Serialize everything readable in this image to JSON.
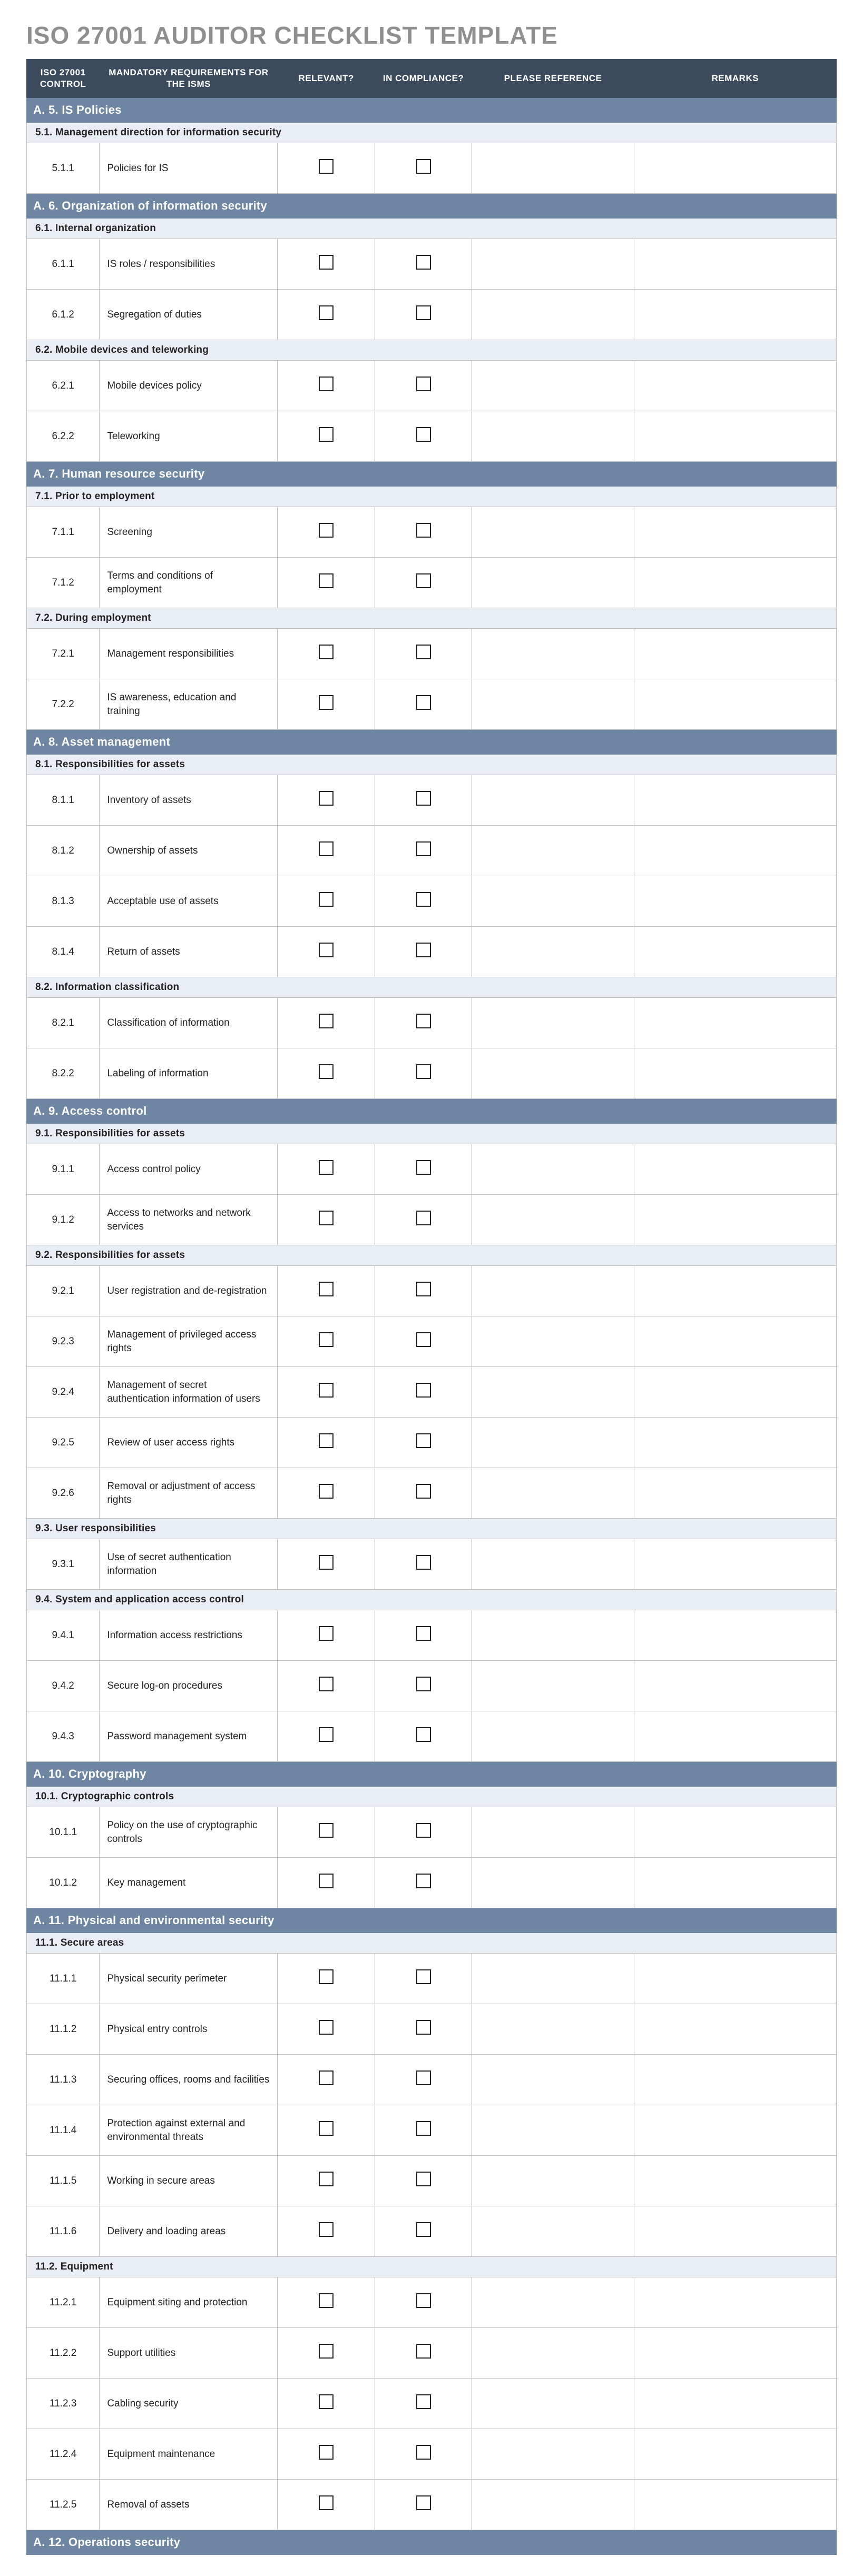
{
  "title": "ISO 27001 AUDITOR CHECKLIST TEMPLATE",
  "columns": {
    "control": "ISO 27001\nCONTROL",
    "req": "MANDATORY REQUIREMENTS\nFOR THE ISMS",
    "relevant": "RELEVANT?",
    "compliance": "IN COMPLIANCE?",
    "reference": "PLEASE REFERENCE",
    "remarks": "REMARKS"
  },
  "sections": [
    {
      "label": "A. 5. IS Policies",
      "subs": [
        {
          "label": "5.1. Management direction for information security",
          "rows": [
            {
              "c": "5.1.1",
              "t": "Policies for IS"
            }
          ]
        }
      ]
    },
    {
      "label": "A. 6. Organization of information security",
      "subs": [
        {
          "label": "6.1. Internal organization",
          "rows": [
            {
              "c": "6.1.1",
              "t": "IS roles / responsibilities"
            },
            {
              "c": "6.1.2",
              "t": "Segregation of duties"
            }
          ]
        },
        {
          "label": "6.2. Mobile devices and teleworking",
          "rows": [
            {
              "c": "6.2.1",
              "t": "Mobile devices policy"
            },
            {
              "c": "6.2.2",
              "t": "Teleworking"
            }
          ]
        }
      ]
    },
    {
      "label": "A. 7. Human resource security",
      "subs": [
        {
          "label": "7.1. Prior to employment",
          "rows": [
            {
              "c": "7.1.1",
              "t": "Screening"
            },
            {
              "c": "7.1.2",
              "t": "Terms and conditions of employment"
            }
          ]
        },
        {
          "label": "7.2. During employment",
          "rows": [
            {
              "c": "7.2.1",
              "t": "Management responsibilities"
            },
            {
              "c": "7.2.2",
              "t": "IS awareness, education and training"
            }
          ]
        }
      ]
    },
    {
      "label": "A. 8. Asset management",
      "subs": [
        {
          "label": "8.1. Responsibilities for assets",
          "rows": [
            {
              "c": "8.1.1",
              "t": "Inventory of assets"
            },
            {
              "c": "8.1.2",
              "t": "Ownership of assets"
            },
            {
              "c": "8.1.3",
              "t": "Acceptable use of assets"
            },
            {
              "c": "8.1.4",
              "t": "Return of assets"
            }
          ]
        },
        {
          "label": "8.2. Information classification",
          "rows": [
            {
              "c": "8.2.1",
              "t": "Classification of information"
            },
            {
              "c": "8.2.2",
              "t": "Labeling of information"
            }
          ]
        }
      ]
    },
    {
      "label": "A. 9. Access control",
      "subs": [
        {
          "label": "9.1. Responsibilities for assets",
          "rows": [
            {
              "c": "9.1.1",
              "t": "Access control policy"
            },
            {
              "c": "9.1.2",
              "t": "Access to networks and network services"
            }
          ]
        },
        {
          "label": "9.2. Responsibilities for assets",
          "rows": [
            {
              "c": "9.2.1",
              "t": "User registration and de-registration"
            },
            {
              "c": "9.2.3",
              "t": "Management of privileged access rights"
            },
            {
              "c": "9.2.4",
              "t": "Management of secret authentication information of users"
            },
            {
              "c": "9.2.5",
              "t": "Review of user access rights"
            },
            {
              "c": "9.2.6",
              "t": "Removal or adjustment of access rights"
            }
          ]
        },
        {
          "label": "9.3. User responsibilities",
          "rows": [
            {
              "c": "9.3.1",
              "t": "Use of secret authentication information"
            }
          ]
        },
        {
          "label": "9.4. System and application access control",
          "rows": [
            {
              "c": "9.4.1",
              "t": "Information access restrictions"
            },
            {
              "c": "9.4.2",
              "t": "Secure log-on procedures"
            },
            {
              "c": "9.4.3",
              "t": "Password management system"
            }
          ]
        }
      ]
    },
    {
      "label": "A. 10. Cryptography",
      "subs": [
        {
          "label": "10.1. Cryptographic controls",
          "rows": [
            {
              "c": "10.1.1",
              "t": "Policy on the use of cryptographic controls"
            },
            {
              "c": "10.1.2",
              "t": "Key management"
            }
          ]
        }
      ]
    },
    {
      "label": "A. 11. Physical and environmental security",
      "subs": [
        {
          "label": "11.1. Secure areas",
          "rows": [
            {
              "c": "11.1.1",
              "t": "Physical security perimeter"
            },
            {
              "c": "11.1.2",
              "t": "Physical entry controls"
            },
            {
              "c": "11.1.3",
              "t": "Securing offices, rooms and facilities"
            },
            {
              "c": "11.1.4",
              "t": "Protection against external and environmental threats"
            },
            {
              "c": "11.1.5",
              "t": "Working in secure areas"
            },
            {
              "c": "11.1.6",
              "t": "Delivery and loading areas"
            }
          ]
        },
        {
          "label": "11.2. Equipment",
          "rows": [
            {
              "c": "11.2.1",
              "t": "Equipment siting and protection"
            },
            {
              "c": "11.2.2",
              "t": "Support utilities"
            },
            {
              "c": "11.2.3",
              "t": "Cabling security"
            },
            {
              "c": "11.2.4",
              "t": "Equipment maintenance"
            },
            {
              "c": "11.2.5",
              "t": "Removal of assets"
            }
          ]
        }
      ]
    },
    {
      "label": "A. 12. Operations security",
      "subs": []
    }
  ]
}
